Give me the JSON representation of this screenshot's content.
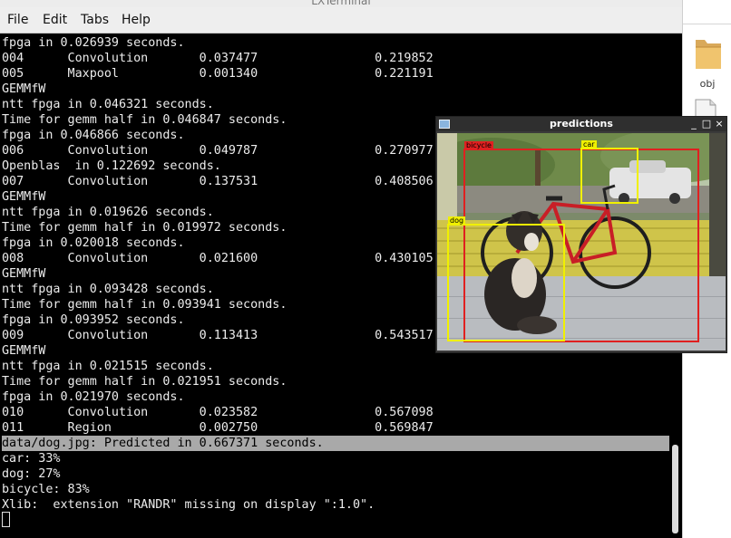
{
  "terminal": {
    "title": "LXTerminal",
    "menu": [
      "File",
      "Edit",
      "Tabs",
      "Help"
    ],
    "lines": [
      "fpga in 0.026939 seconds.",
      "004      Convolution       0.037477                0.219852",
      "005      Maxpool           0.001340                0.221191",
      "GEMMfW",
      "ntt fpga in 0.046321 seconds.",
      "Time for gemm half in 0.046847 seconds.",
      "fpga in 0.046866 seconds.",
      "006      Convolution       0.049787                0.270977",
      "Openblas  in 0.122692 seconds.",
      "007      Convolution       0.137531                0.408506",
      "GEMMfW",
      "ntt fpga in 0.019626 seconds.",
      "Time for gemm half in 0.019972 seconds.",
      "fpga in 0.020018 seconds.",
      "008      Convolution       0.021600                0.430105",
      "GEMMfW",
      "ntt fpga in 0.093428 seconds.",
      "Time for gemm half in 0.093941 seconds.",
      "fpga in 0.093952 seconds.",
      "009      Convolution       0.113413                0.543517",
      "GEMMfW",
      "ntt fpga in 0.021515 seconds.",
      "Time for gemm half in 0.021951 seconds.",
      "fpga in 0.021970 seconds.",
      "010      Convolution       0.023582                0.567098",
      "011      Region            0.002750                0.569847",
      "data/dog.jpg: Predicted in 0.667371 seconds.",
      "car: 33%",
      "dog: 27%",
      "bicycle: 83%",
      "Xlib:  extension \"RANDR\" missing on display \":1.0\"."
    ],
    "highlighted_line_index": 26
  },
  "desktop": {
    "folder_label": "obj"
  },
  "predictions": {
    "title": "predictions",
    "controls": {
      "minimize": "_",
      "maximize": "□",
      "close": "×"
    },
    "boxes": [
      {
        "label": "bicycle",
        "color": "#e02020",
        "text_color": "#000000"
      },
      {
        "label": "car",
        "color": "#f0f000",
        "text_color": "#000000"
      },
      {
        "label": "dog",
        "color": "#f0f000",
        "text_color": "#000000"
      }
    ]
  }
}
